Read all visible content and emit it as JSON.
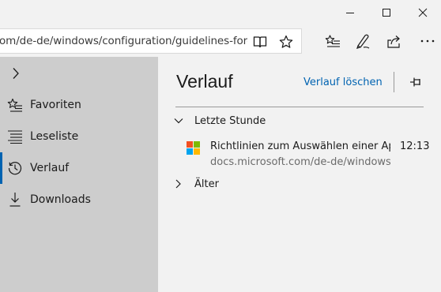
{
  "browser": {
    "address": "om/de-de/windows/configuration/guidelines-for-assig"
  },
  "hub": {
    "items": [
      {
        "label": "Favoriten",
        "icon": "star-list-icon"
      },
      {
        "label": "Leseliste",
        "icon": "reading-list-icon"
      },
      {
        "label": "Verlauf",
        "icon": "history-icon",
        "active": true
      },
      {
        "label": "Downloads",
        "icon": "download-icon"
      }
    ]
  },
  "history": {
    "title": "Verlauf",
    "clear_label": "Verlauf löschen",
    "groups": [
      {
        "label": "Letzte Stunde",
        "expanded": true
      },
      {
        "label": "Älter",
        "expanded": false
      }
    ],
    "entries": [
      {
        "title": "Richtlinien zum Auswählen einer App für",
        "url": "docs.microsoft.com/de-de/windows/configuration/guidelines",
        "time": "12:13"
      }
    ]
  },
  "colors": {
    "accent": "#0063b1",
    "hub_bg": "#cdcdcd",
    "pane_bg": "#f2f2f2"
  }
}
